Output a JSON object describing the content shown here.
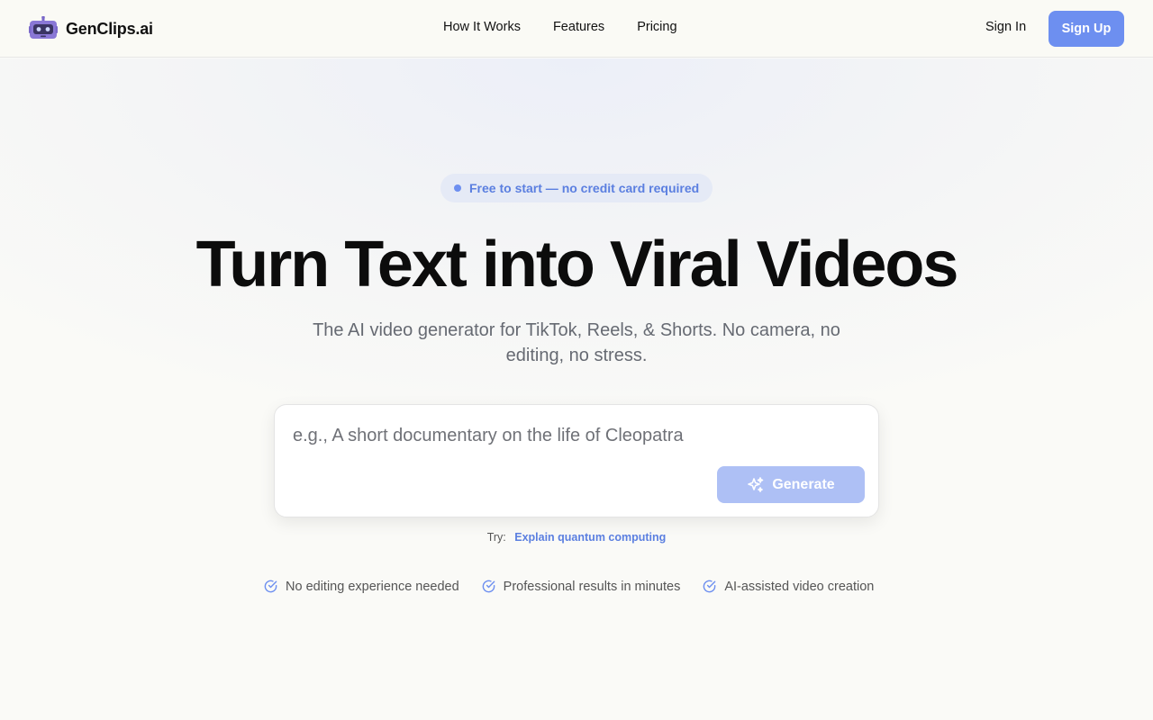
{
  "header": {
    "brand": "GenClips.ai",
    "nav": [
      "How It Works",
      "Features",
      "Pricing"
    ],
    "sign_in": "Sign In",
    "sign_up": "Sign Up"
  },
  "hero": {
    "badge": "Free to start — no credit card required",
    "headline": "Turn Text into Viral Videos",
    "subhead": "The AI video generator for TikTok, Reels, & Shorts. No camera, no editing, no stress.",
    "prompt_placeholder": "e.g., A short documentary on the life of Cleopatra",
    "generate_label": "Generate",
    "try_label": "Try:",
    "try_suggestion": "Explain quantum computing",
    "features": [
      "No editing experience needed",
      "Professional results in minutes",
      "AI-assisted video creation"
    ]
  },
  "colors": {
    "accent": "#6d8ff0",
    "accent_light": "#aec0f5",
    "badge_bg": "#e5eaf6",
    "logo_purple": "#8a78d6"
  },
  "icons": {
    "logo": "robot-icon",
    "generate": "sparkles-icon",
    "feature": "check-circle-icon"
  }
}
